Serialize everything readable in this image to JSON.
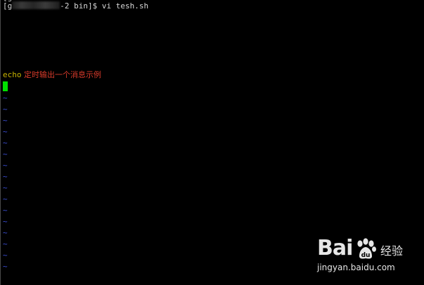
{
  "terminal": {
    "top_cut_line": "[g",
    "prompt": {
      "prefix": "[g",
      "suffix": "-2 bin]$ vi tesh.sh"
    },
    "code": {
      "keyword": "echo",
      "argument": " 定时输出一个消息示例"
    },
    "empty_line_marker": "~",
    "colors": {
      "background": "#000000",
      "prompt_text": "#d8d8d8",
      "keyword": "#c8b400",
      "string": "#d83a2a",
      "cursor": "#00e000",
      "tilde": "#3b4fd8"
    }
  },
  "watermark": {
    "brand": "Bai",
    "brand_icon": "baidu-paw-icon",
    "product": "经验",
    "url": "jingyan.baidu.com"
  }
}
